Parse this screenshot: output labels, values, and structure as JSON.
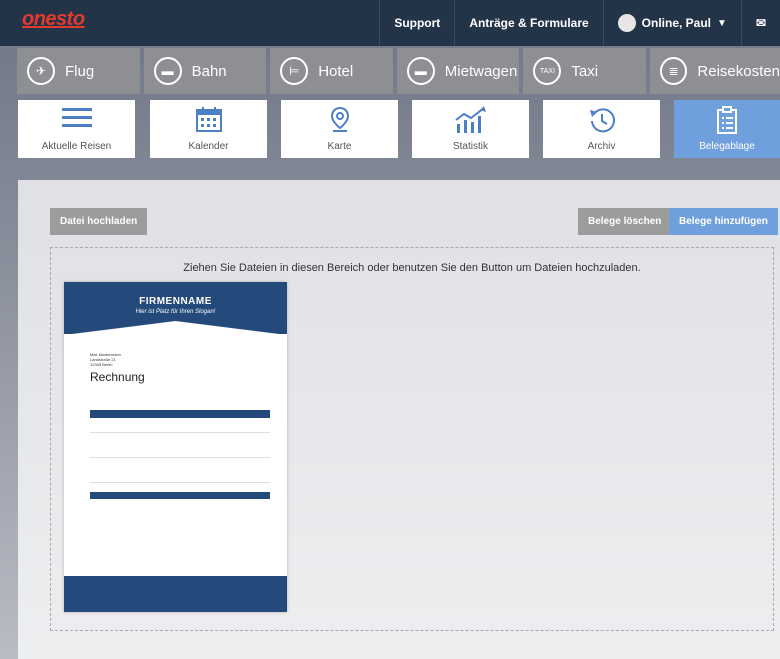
{
  "brand": {
    "logo_text": "onesto"
  },
  "topnav": {
    "support": "Support",
    "forms": "Anträge & Formulare",
    "user": "Online, Paul",
    "user_caret": "▼",
    "mail_icon": "✉"
  },
  "transport": [
    {
      "label": "Flug",
      "icon": "plane-icon",
      "glyph": "✈"
    },
    {
      "label": "Bahn",
      "icon": "train-icon",
      "glyph": "▬"
    },
    {
      "label": "Hotel",
      "icon": "bed-icon",
      "glyph": "⊨"
    },
    {
      "label": "Mietwagen",
      "icon": "car-icon",
      "glyph": "▬"
    },
    {
      "label": "Taxi",
      "icon": "taxi-icon",
      "glyph": "TAXI"
    },
    {
      "label": "Reisekosten",
      "icon": "receipt-icon",
      "glyph": "≣"
    }
  ],
  "tiles": [
    {
      "label": "Aktuelle Reisen",
      "icon": "list-icon"
    },
    {
      "label": "Kalender",
      "icon": "calendar-icon"
    },
    {
      "label": "Karte",
      "icon": "map-pin-icon"
    },
    {
      "label": "Statistik",
      "icon": "chart-icon"
    },
    {
      "label": "Archiv",
      "icon": "history-icon"
    },
    {
      "label": "Belegablage",
      "icon": "clipboard-icon",
      "active": true
    }
  ],
  "upload": {
    "upload_button": "Datei hochladen",
    "delete_button": "Belege löschen",
    "add_button": "Belege hinzufügen",
    "dropzone_text": "Ziehen Sie Dateien in diesen Bereich oder benutzen Sie den Button um Dateien hochzuladen."
  },
  "invoice": {
    "firm": "FIRMENNAME",
    "tagline": "Hier ist Platz für Ihren Slogan!",
    "recipient": "Max Mustermann\nLandstraße 21\n12345 Berlin",
    "title": "Rechnung"
  },
  "colors": {
    "topbar": "#243448",
    "accent_blue": "#6f9fdc",
    "invoice_blue": "#234a7a",
    "logo_red": "#e23b2e"
  }
}
